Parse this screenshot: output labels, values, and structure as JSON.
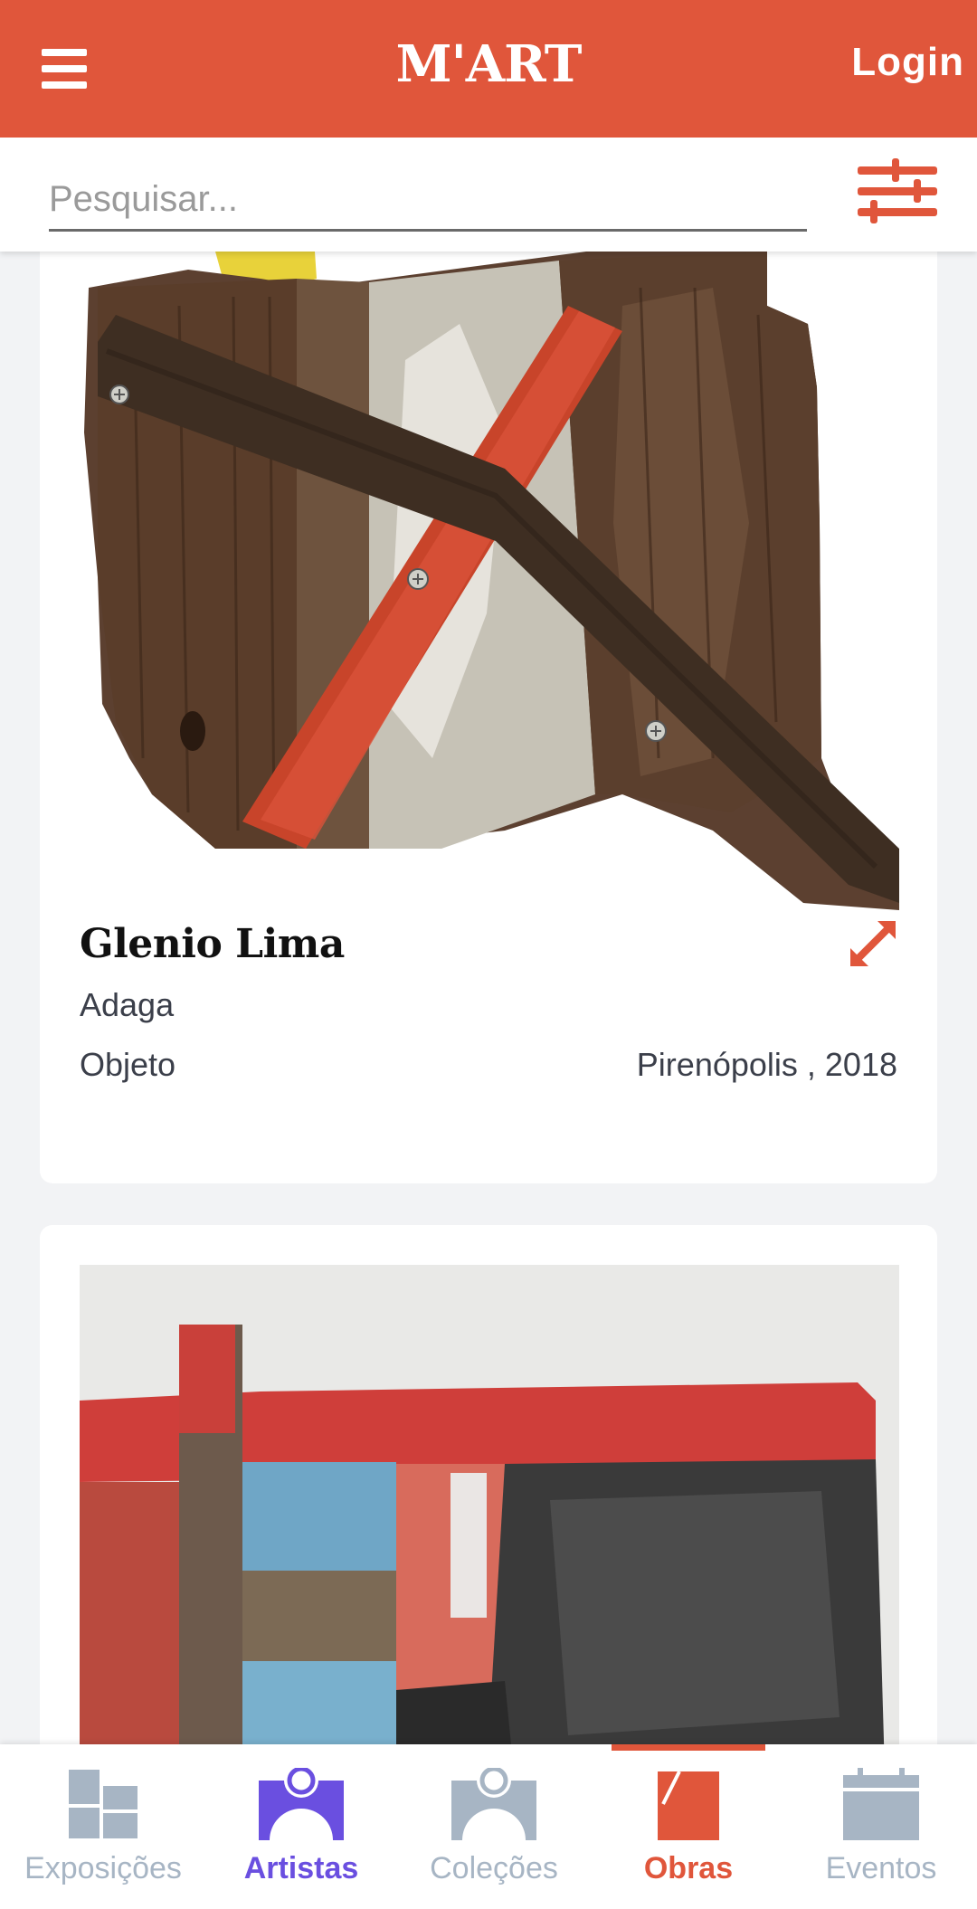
{
  "header": {
    "logo": "M'ART",
    "login_label": "Login"
  },
  "search": {
    "placeholder": "Pesquisar..."
  },
  "cards": [
    {
      "artist": "Glenio Lima",
      "title": "Adaga",
      "type": "Objeto",
      "place_year": "Pirenópolis , 2018"
    }
  ],
  "nav": {
    "items": [
      {
        "label": "Exposições",
        "color": "#a7b5c4"
      },
      {
        "label": "Artistas",
        "color": "#6a4fe0"
      },
      {
        "label": "Coleções",
        "color": "#a7b5c4"
      },
      {
        "label": "Obras",
        "color": "#e0563b"
      },
      {
        "label": "Eventos",
        "color": "#a7b5c4"
      }
    ],
    "active": "Obras"
  },
  "colors": {
    "accent": "#e0563b",
    "artists": "#6a4fe0",
    "inactive": "#a7b5c4"
  }
}
